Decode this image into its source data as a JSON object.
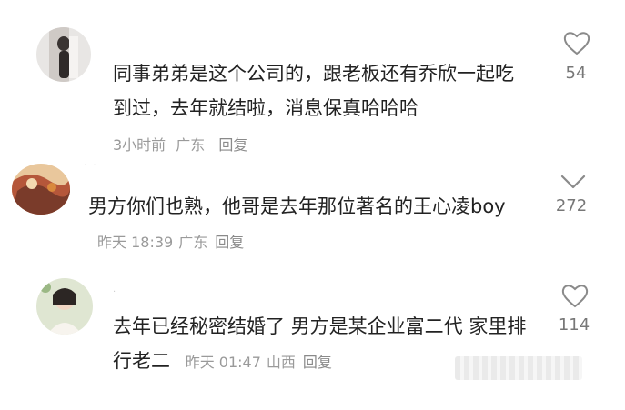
{
  "comments": [
    {
      "text": "同事弟弟是这个公司的，跟老板还有乔欣一起吃到过，去年就结啦，消息保真哈哈哈",
      "time": "3小时前",
      "location": "广东",
      "reply_label": "回复",
      "likes": "54"
    },
    {
      "text": "男方你们也熟，他哥是去年那位著名的王心凌boy",
      "time": "昨天 18:39",
      "location": "广东",
      "reply_label": "回复",
      "likes": "272"
    },
    {
      "text": "去年已经秘密结婚了 男方是某企业富二代 家里排行老二",
      "time": "昨天 01:47",
      "location": "山西",
      "reply_label": "回复",
      "likes": "114"
    }
  ],
  "colors": {
    "text": "#222222",
    "meta": "#9a9a9a",
    "icon": "#8a8a8a"
  },
  "icons": {
    "like": "heart-outline-icon",
    "unlike": "chevron-down-icon"
  }
}
